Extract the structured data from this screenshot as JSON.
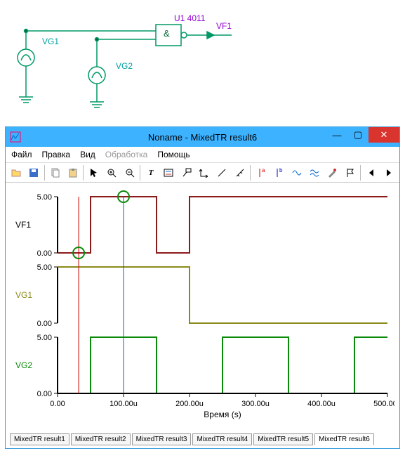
{
  "schematic": {
    "vg1_label": "VG1",
    "vg2_label": "VG2",
    "u1_label": "U1 4011",
    "vf1_label": "VF1",
    "gate_symbol": "&"
  },
  "window": {
    "title": "Noname - MixedTR result6"
  },
  "menu": {
    "file": "Файл",
    "edit": "Правка",
    "view": "Вид",
    "process": "Обработка",
    "help": "Помощь"
  },
  "toolbar_icons": [
    "open-icon",
    "save-icon",
    "copy-icon",
    "paste-icon",
    "pointer-icon",
    "zoom-in-icon",
    "zoom-out-icon",
    "text-icon",
    "legend-icon",
    "annotate-icon",
    "axis-icon",
    "line-icon",
    "ruler-icon",
    "cursor-a-icon",
    "cursor-b-icon",
    "wave-icon",
    "wave2-icon",
    "probe-icon",
    "flag-icon",
    "prev-icon",
    "next-icon"
  ],
  "charts": {
    "xlabel": "Время (s)",
    "x_ticks": [
      "0.00",
      "100.00u",
      "200.00u",
      "300.00u",
      "400.00u",
      "500.00u"
    ],
    "cursor_a_x": 32,
    "cursor_b_x": 100,
    "series": [
      {
        "name": "VF1",
        "color": "#8b1a1a",
        "ylabel_color": "#000",
        "y_ticks": [
          "5.00",
          "0.00"
        ],
        "points": [
          [
            0,
            0
          ],
          [
            50,
            0
          ],
          [
            50,
            5
          ],
          [
            150,
            5
          ],
          [
            150,
            0
          ],
          [
            200,
            0
          ],
          [
            200,
            5
          ],
          [
            500,
            5
          ]
        ]
      },
      {
        "name": "VG1",
        "color": "#8a8a1a",
        "ylabel_color": "#8a8a1a",
        "y_ticks": [
          "5.00",
          "0.00"
        ],
        "points": [
          [
            0,
            5
          ],
          [
            200,
            5
          ],
          [
            200,
            0
          ],
          [
            500,
            0
          ]
        ]
      },
      {
        "name": "VG2",
        "color": "#0a8a0a",
        "ylabel_color": "#0a8a0a",
        "y_ticks": [
          "5.00",
          "0.00"
        ],
        "points": [
          [
            0,
            0
          ],
          [
            50,
            0
          ],
          [
            50,
            5
          ],
          [
            150,
            5
          ],
          [
            150,
            0
          ],
          [
            250,
            0
          ],
          [
            250,
            5
          ],
          [
            350,
            5
          ],
          [
            350,
            0
          ],
          [
            450,
            0
          ],
          [
            450,
            5
          ],
          [
            500,
            5
          ]
        ]
      }
    ]
  },
  "tabs": [
    {
      "label": "MixedTR result1",
      "active": false
    },
    {
      "label": "MixedTR result2",
      "active": false
    },
    {
      "label": "MixedTR result3",
      "active": false
    },
    {
      "label": "MixedTR result4",
      "active": false
    },
    {
      "label": "MixedTR result5",
      "active": false
    },
    {
      "label": "MixedTR result6",
      "active": true
    }
  ],
  "chart_data": [
    {
      "type": "line",
      "title": "VF1",
      "xlabel": "Время (s)",
      "ylabel": "",
      "xlim": [
        0,
        500
      ],
      "ylim": [
        0,
        5
      ],
      "x_tick_labels": [
        "0.00",
        "100.00u",
        "200.00u",
        "300.00u",
        "400.00u",
        "500.00u"
      ],
      "y_tick_labels": [
        "0.00",
        "5.00"
      ],
      "cursors": [
        {
          "name": "a",
          "x": 32
        },
        {
          "name": "b",
          "x": 100
        }
      ],
      "series": [
        {
          "name": "VF1",
          "color": "#8b1a1a",
          "x": [
            0,
            50,
            50,
            150,
            150,
            200,
            200,
            500
          ],
          "y": [
            0,
            0,
            5,
            5,
            0,
            0,
            5,
            5
          ]
        }
      ]
    },
    {
      "type": "line",
      "title": "VG1",
      "xlabel": "Время (s)",
      "ylabel": "",
      "xlim": [
        0,
        500
      ],
      "ylim": [
        0,
        5
      ],
      "series": [
        {
          "name": "VG1",
          "color": "#8a8a1a",
          "x": [
            0,
            200,
            200,
            500
          ],
          "y": [
            5,
            5,
            0,
            0
          ]
        }
      ]
    },
    {
      "type": "line",
      "title": "VG2",
      "xlabel": "Время (s)",
      "ylabel": "",
      "xlim": [
        0,
        500
      ],
      "ylim": [
        0,
        5
      ],
      "series": [
        {
          "name": "VG2",
          "color": "#0a8a0a",
          "x": [
            0,
            50,
            50,
            150,
            150,
            250,
            250,
            350,
            350,
            450,
            450,
            500
          ],
          "y": [
            0,
            0,
            5,
            5,
            0,
            0,
            5,
            5,
            0,
            0,
            5,
            5
          ]
        }
      ]
    }
  ]
}
